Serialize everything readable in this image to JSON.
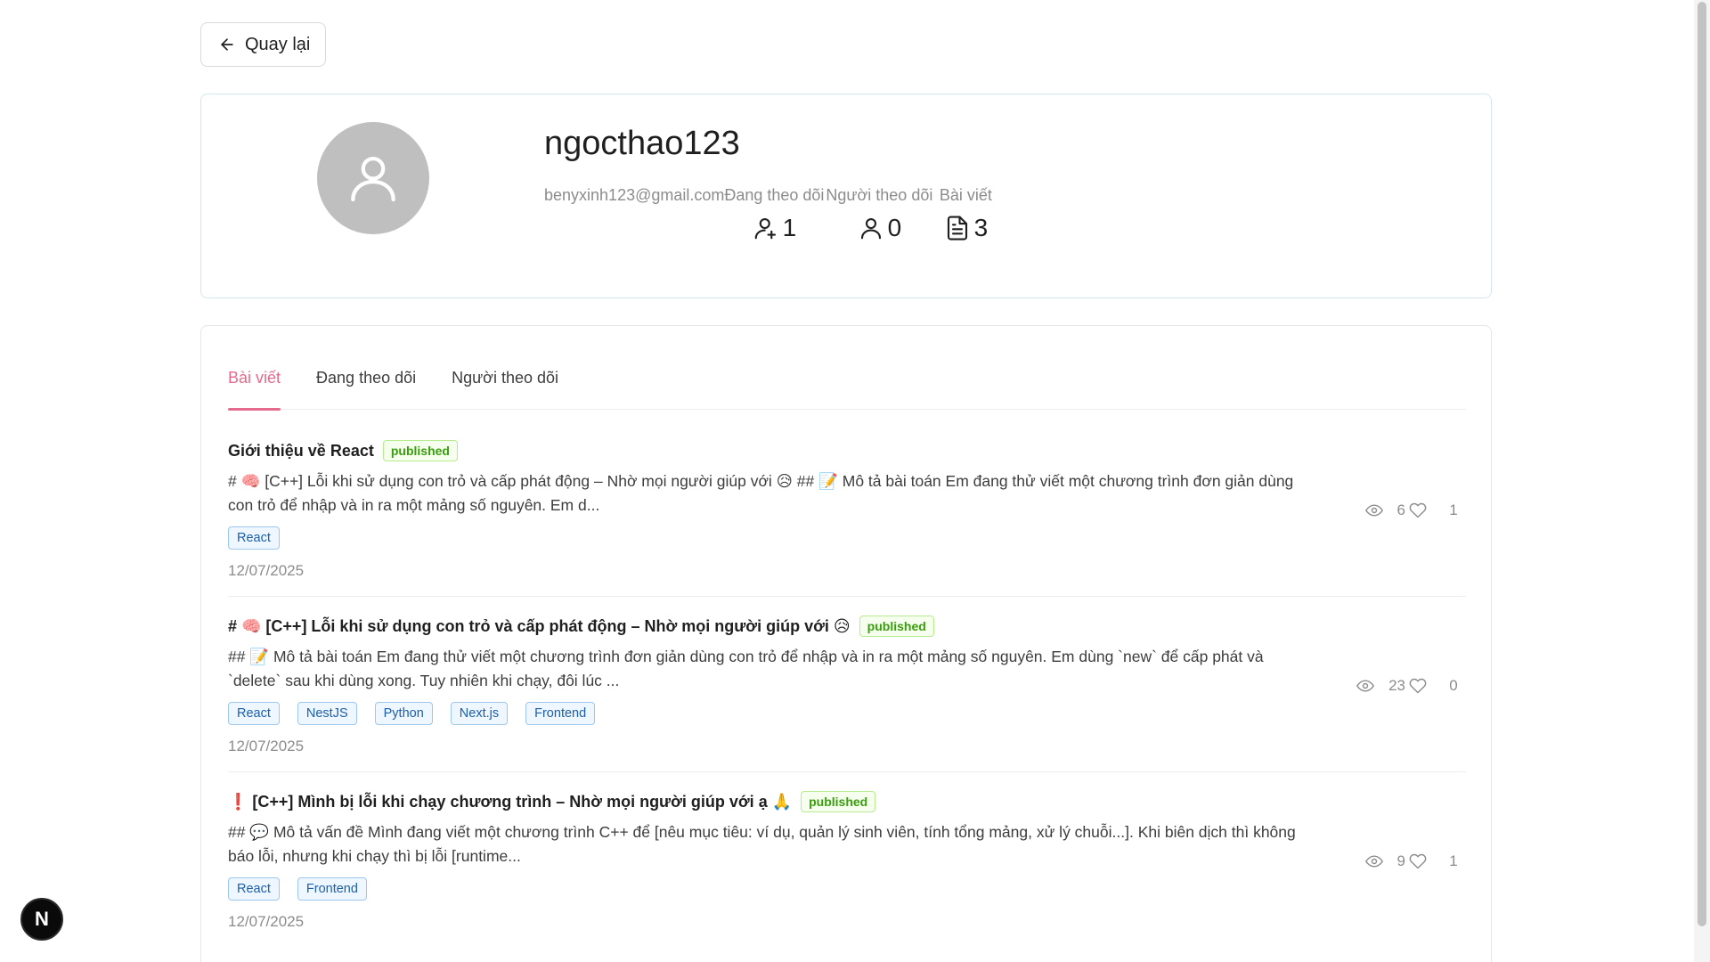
{
  "back_button": {
    "label": "Quay lại",
    "icon": "arrow-left-icon"
  },
  "profile": {
    "username": "ngocthao123",
    "email": "benyxinh123@gmail.com",
    "avatar_icon": "user-icon",
    "stats": {
      "following": {
        "label": "Đang theo dõi",
        "value": "1",
        "icon": "user-add-icon"
      },
      "followers": {
        "label": "Người theo dõi",
        "value": "0",
        "icon": "user-icon"
      },
      "posts": {
        "label": "Bài viết",
        "value": "3",
        "icon": "file-text-icon"
      }
    }
  },
  "tabs": [
    {
      "label": "Bài viết",
      "active": true
    },
    {
      "label": "Đang theo dõi",
      "active": false
    },
    {
      "label": "Người theo dõi",
      "active": false
    }
  ],
  "posts": [
    {
      "title": "Giới thiệu về React",
      "status": "published",
      "excerpt": "# 🧠 [C++] Lỗi khi sử dụng con trỏ và cấp phát động – Nhờ mọi người giúp với 😥 ## 📝 Mô tả bài toán Em đang thử viết một chương trình đơn giản dùng con trỏ để nhập và in ra một mảng số nguyên. Em d...",
      "tags": [
        "React"
      ],
      "date": "12/07/2025",
      "views": "6",
      "likes": "1"
    },
    {
      "title": "# 🧠 [C++] Lỗi khi sử dụng con trỏ và cấp phát động – Nhờ mọi người giúp với 😥",
      "status": "published",
      "excerpt": "## 📝 Mô tả bài toán Em đang thử viết một chương trình đơn giản dùng con trỏ để nhập và in ra một mảng số nguyên. Em dùng `new` để cấp phát và `delete` sau khi dùng xong. Tuy nhiên khi chạy, đôi lúc ...",
      "tags": [
        "React",
        "NestJS",
        "Python",
        "Next.js",
        "Frontend"
      ],
      "date": "12/07/2025",
      "views": "23",
      "likes": "0"
    },
    {
      "title": "❗ [C++] Mình bị lỗi khi chạy chương trình – Nhờ mọi người giúp với ạ 🙏",
      "status": "published",
      "excerpt": "## 💬 Mô tả vấn đề Mình đang viết một chương trình C++ để [nêu mục tiêu: ví dụ, quản lý sinh viên, tính tổng mảng, xử lý chuỗi...]. Khi biên dịch thì không báo lỗi, nhưng khi chạy thì bị lỗi [runtime...",
      "tags": [
        "React",
        "Frontend"
      ],
      "date": "12/07/2025",
      "views": "9",
      "likes": "1"
    }
  ],
  "dev_indicator": {
    "label": "N"
  },
  "colors": {
    "accent": "#e56b8e",
    "published_text": "#389e0d",
    "tag_text": "#1d5fa8"
  }
}
